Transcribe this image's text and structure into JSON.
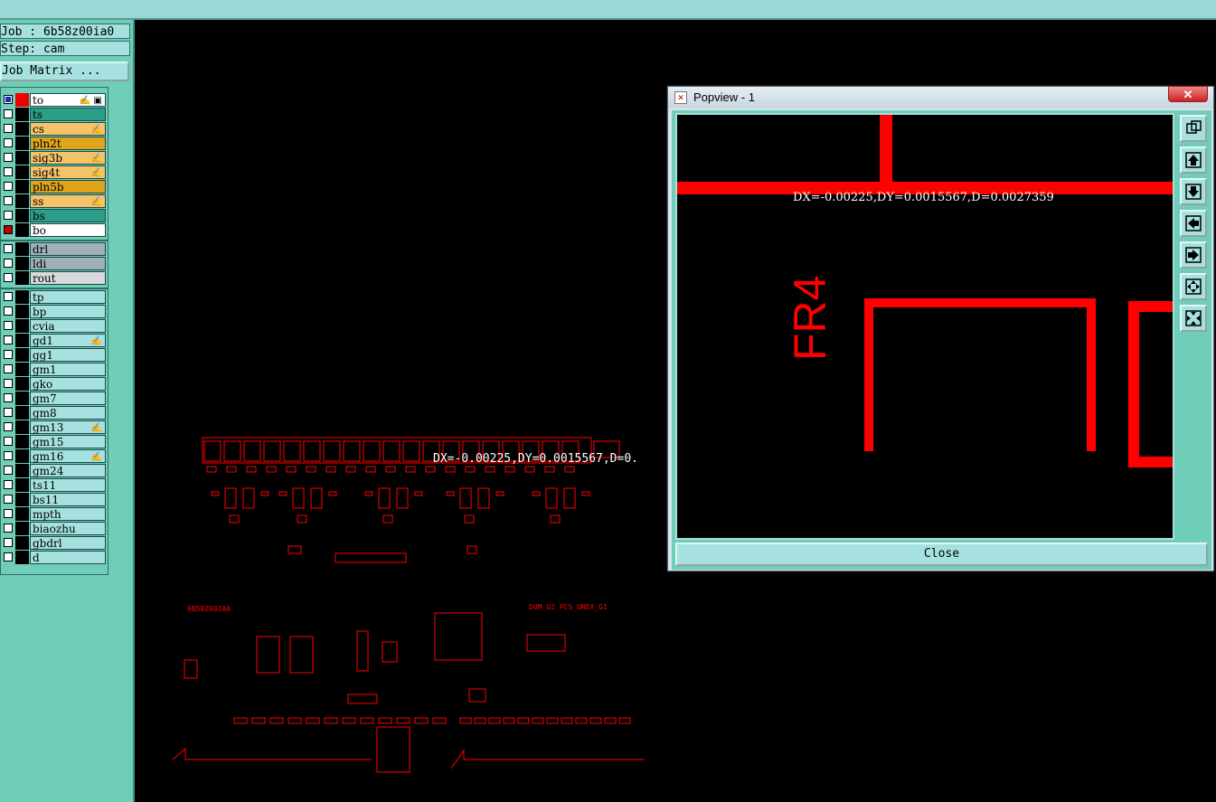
{
  "info": {
    "job": "Job : 6b58z00ia0",
    "step": "Step: cam",
    "matrix_button": "Job Matrix ..."
  },
  "layers_group1": [
    {
      "name": "to",
      "color": "#ffffff",
      "selected": "blue",
      "mark": "✍ ▣"
    },
    {
      "name": "ts",
      "color": "#2a9e88",
      "selected": "",
      "mark": ""
    },
    {
      "name": "cs",
      "color": "#f5c36a",
      "selected": "",
      "mark": "✍"
    },
    {
      "name": "pln2t",
      "color": "#e0a41c",
      "selected": "",
      "mark": ""
    },
    {
      "name": "sig3b",
      "color": "#f5c36a",
      "selected": "",
      "mark": "✍"
    },
    {
      "name": "sig4t",
      "color": "#f5c36a",
      "selected": "",
      "mark": "✍"
    },
    {
      "name": "pln5b",
      "color": "#e0a41c",
      "selected": "",
      "mark": ""
    },
    {
      "name": "ss",
      "color": "#f5c36a",
      "selected": "",
      "mark": "✍"
    },
    {
      "name": "bs",
      "color": "#2a9e88",
      "selected": "",
      "mark": ""
    },
    {
      "name": "bo",
      "color": "#ffffff",
      "selected": "red",
      "mark": ""
    }
  ],
  "layers_group2": [
    {
      "name": "drl",
      "color": "#9fb0b8",
      "selected": "",
      "mark": ""
    },
    {
      "name": "ldi",
      "color": "#9fb0b8",
      "selected": "",
      "mark": ""
    },
    {
      "name": "rout",
      "color": "#d7d9dc",
      "selected": "",
      "mark": ""
    }
  ],
  "layers_group3": [
    {
      "name": "tp",
      "mark": ""
    },
    {
      "name": "bp",
      "mark": ""
    },
    {
      "name": "cvia",
      "mark": ""
    },
    {
      "name": "gd1",
      "mark": "✍"
    },
    {
      "name": "gg1",
      "mark": ""
    },
    {
      "name": "gm1",
      "mark": ""
    },
    {
      "name": "gko",
      "mark": ""
    },
    {
      "name": "gm7",
      "mark": ""
    },
    {
      "name": "gm8",
      "mark": ""
    },
    {
      "name": "gm13",
      "mark": "✍"
    },
    {
      "name": "gm15",
      "mark": ""
    },
    {
      "name": "gm16",
      "mark": "✍"
    },
    {
      "name": "gm24",
      "mark": ""
    },
    {
      "name": "ts11",
      "mark": ""
    },
    {
      "name": "bs11",
      "mark": ""
    },
    {
      "name": "mpth",
      "mark": ""
    },
    {
      "name": "biaozhu",
      "mark": ""
    },
    {
      "name": "gbdrl",
      "mark": ""
    },
    {
      "name": "d",
      "mark": ""
    }
  ],
  "canvas": {
    "measure_text": "DX=-0.00225,DY=0.0015567,D=0.",
    "label_left": "6B58Z00IA0",
    "label_right": "DUM_U2 PCS_UNEX_G1"
  },
  "popup": {
    "title": "Popview - 1",
    "close_x": "✕",
    "measure_text": "DX=-0.00225,DY=0.0015567,D=0.0027359",
    "material_text": "FR4",
    "close_button": "Close",
    "tools": [
      "zoom-fit-icon",
      "zoom-up-icon",
      "zoom-down-icon",
      "pan-left-icon",
      "pan-right-icon",
      "zoom-in-icon",
      "zoom-out-icon"
    ]
  },
  "colors": {
    "feature_red": "#ff0000",
    "panel_teal": "#6fcdb8",
    "button_cyan": "#a6e1e0"
  }
}
